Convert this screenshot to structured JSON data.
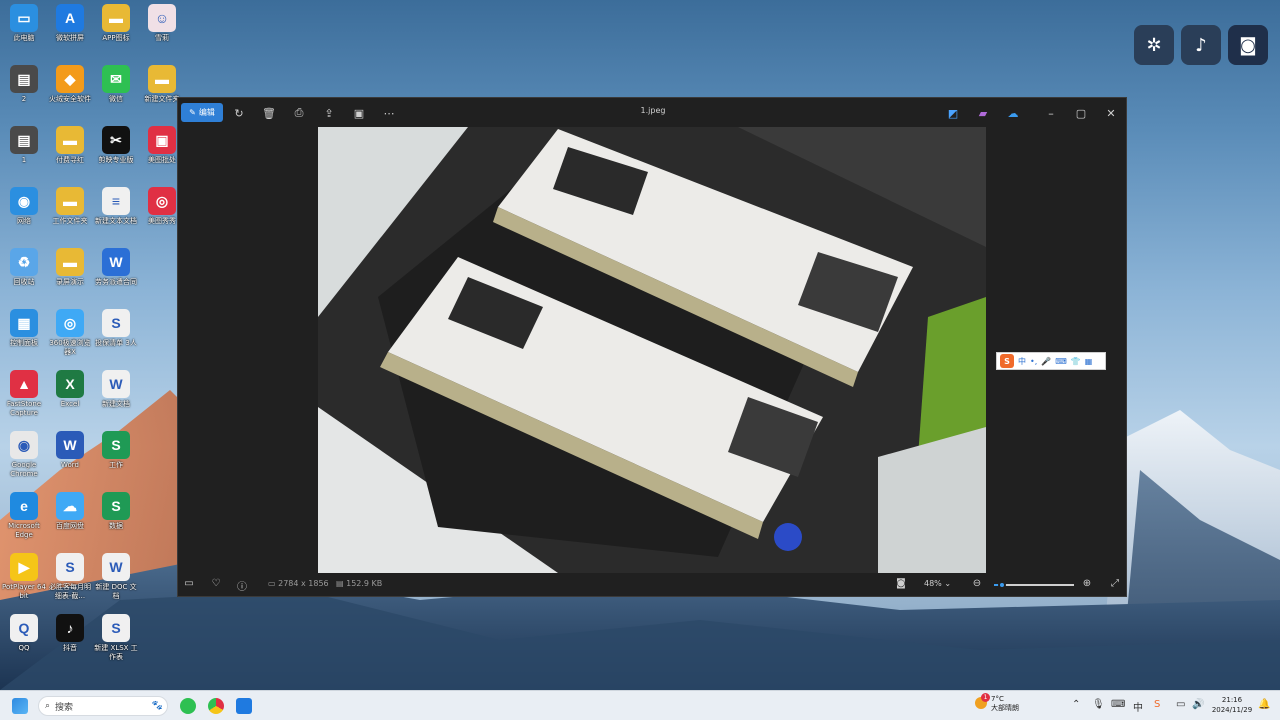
{
  "desktop_icons": [
    {
      "label": "此电脑",
      "color": "#2b8fe0",
      "glyph": "▭"
    },
    {
      "label": "微软拼屏",
      "color": "#1f7ae0",
      "glyph": "A"
    },
    {
      "label": "APP图标",
      "color": "#e8b935",
      "glyph": "▬"
    },
    {
      "label": "雪莉",
      "color": "#f0e0e6",
      "glyph": "☺"
    },
    {
      "label": "2",
      "color": "#4a4a4a",
      "glyph": "▤"
    },
    {
      "label": "火绒安全软件",
      "color": "#f39b1a",
      "glyph": "◆"
    },
    {
      "label": "微信",
      "color": "#2ec052",
      "glyph": "✉"
    },
    {
      "label": "新建文件夹",
      "color": "#e8b935",
      "glyph": "▬"
    },
    {
      "label": "1",
      "color": "#4a4a4a",
      "glyph": "▤"
    },
    {
      "label": "付费寻红",
      "color": "#e8b935",
      "glyph": "▬"
    },
    {
      "label": "剪映专业版",
      "color": "#111111",
      "glyph": "✂"
    },
    {
      "label": "美图批处",
      "color": "#e03044",
      "glyph": "▣"
    },
    {
      "label": "网络",
      "color": "#2b8fe0",
      "glyph": "◉"
    },
    {
      "label": "工作文件夹",
      "color": "#e8b935",
      "glyph": "▬"
    },
    {
      "label": "新建文本文档",
      "color": "#f0f0f0",
      "glyph": "≡"
    },
    {
      "label": "美图秀秀",
      "color": "#e03044",
      "glyph": "◎"
    },
    {
      "label": "回收站",
      "color": "#5aa6e8",
      "glyph": "♻"
    },
    {
      "label": "录屏演示",
      "color": "#e8b935",
      "glyph": "▬"
    },
    {
      "label": "劳务派遣合同",
      "color": "#2b6fd6",
      "glyph": "W"
    },
    {
      "label": "控制面板",
      "color": "#2b8fe0",
      "glyph": "▦"
    },
    {
      "label": "360极速浏览器X",
      "color": "#3fa9f5",
      "glyph": "◎"
    },
    {
      "label": "投保清单 3人",
      "color": "#f0f0f0",
      "glyph": "S"
    },
    {
      "label": "FastStone Capture",
      "color": "#e03044",
      "glyph": "▲"
    },
    {
      "label": "Excel",
      "color": "#1f7a43",
      "glyph": "X"
    },
    {
      "label": "新建文档",
      "color": "#f0f0f0",
      "glyph": "W"
    },
    {
      "label": "Google Chrome",
      "color": "#e8e8e8",
      "glyph": "◉"
    },
    {
      "label": "Word",
      "color": "#2b5bb8",
      "glyph": "W"
    },
    {
      "label": "工作",
      "color": "#1f9a55",
      "glyph": "S"
    },
    {
      "label": "Microsoft Edge",
      "color": "#1f8ae0",
      "glyph": "e"
    },
    {
      "label": "百度网盘",
      "color": "#3fa9f5",
      "glyph": "☁"
    },
    {
      "label": "数据",
      "color": "#1f9a55",
      "glyph": "S"
    },
    {
      "label": "PotPlayer 64 bit",
      "color": "#f5c518",
      "glyph": "▶"
    },
    {
      "label": "必胜客每月明细表-截...",
      "color": "#f0f0f0",
      "glyph": "S"
    },
    {
      "label": "新建 DOC 文档",
      "color": "#f0f0f0",
      "glyph": "W"
    },
    {
      "label": "QQ",
      "color": "#f0f0f0",
      "glyph": "Q"
    },
    {
      "label": "抖音",
      "color": "#111111",
      "glyph": "♪"
    },
    {
      "label": "新建 XLSX 工作表",
      "color": "#f0f0f0",
      "glyph": "S"
    }
  ],
  "window": {
    "title": "1.jpeg",
    "edit_label": "编辑",
    "toolbar_icons": [
      "rotate-icon",
      "delete-icon",
      "print-icon",
      "share-icon",
      "slideshow-icon",
      "more-icon"
    ],
    "status": {
      "dimensions": "2784 x 1856",
      "filesize": "152.9 KB",
      "zoom": "48%"
    }
  },
  "ime_bar": {
    "label": "中"
  },
  "taskbar": {
    "search_placeholder": "搜索",
    "weather_temp": "7°C",
    "weather_desc": "大部晴朗",
    "time": "21:16",
    "date": "2024/11/29",
    "notification_count": "1"
  },
  "colors": {
    "accent": "#2f7fd6",
    "window_bg": "#202020"
  }
}
